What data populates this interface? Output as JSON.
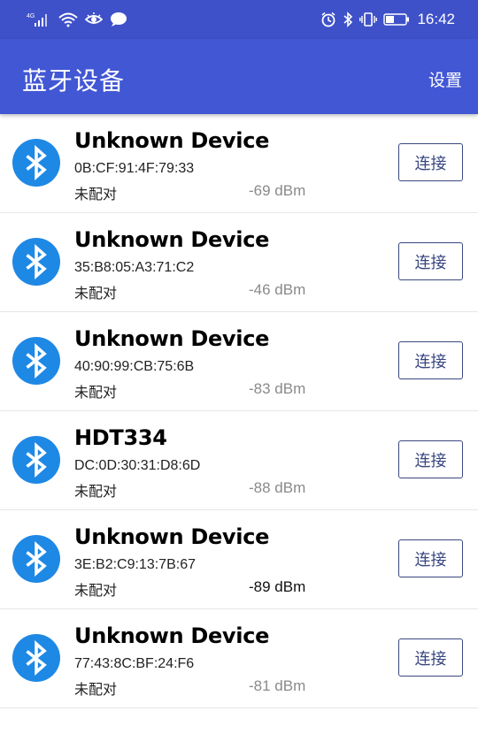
{
  "status_bar": {
    "network_label": "4G",
    "time": "16:42",
    "icons": [
      "signal-icon",
      "wifi-icon",
      "eye-icon",
      "message-icon",
      "alarm-icon",
      "bluetooth-status-icon",
      "vibrate-icon",
      "battery-icon"
    ]
  },
  "app_bar": {
    "title": "蓝牙设备",
    "settings_label": "设置"
  },
  "colors": {
    "status_bar": "#3f51c9",
    "app_bar": "#4157d4",
    "bluetooth_icon_bg": "#1e88e5",
    "button_border": "#3a4780"
  },
  "devices": [
    {
      "name": "Unknown Device",
      "mac": "0B:CF:91:4F:79:33",
      "status": "未配对",
      "rssi": "-69 dBm",
      "connect_label": "连接"
    },
    {
      "name": "Unknown Device",
      "mac": "35:B8:05:A3:71:C2",
      "status": "未配对",
      "rssi": "-46 dBm",
      "connect_label": "连接"
    },
    {
      "name": "Unknown Device",
      "mac": "40:90:99:CB:75:6B",
      "status": "未配对",
      "rssi": "-83 dBm",
      "connect_label": "连接"
    },
    {
      "name": "HDT334",
      "mac": "DC:0D:30:31:D8:6D",
      "status": "未配对",
      "rssi": "-88 dBm",
      "connect_label": "连接"
    },
    {
      "name": "Unknown Device",
      "mac": "3E:B2:C9:13:7B:67",
      "status": "未配对",
      "rssi": "-89 dBm",
      "connect_label": "连接"
    },
    {
      "name": "Unknown Device",
      "mac": "77:43:8C:BF:24:F6",
      "status": "未配对",
      "rssi": "-81 dBm",
      "connect_label": "连接"
    }
  ]
}
